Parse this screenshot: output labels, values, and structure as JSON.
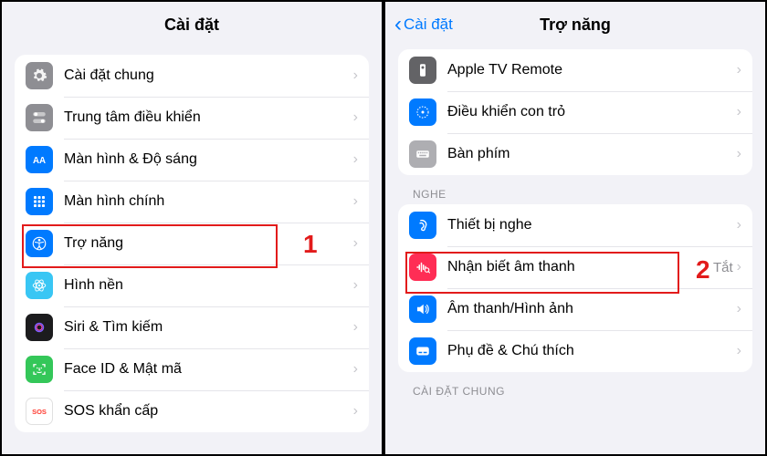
{
  "left": {
    "title": "Cài đặt",
    "items": [
      {
        "name": "general",
        "label": "Cài đặt chung",
        "icon": "gear",
        "bg": "bg-gray"
      },
      {
        "name": "controlcenter",
        "label": "Trung tâm điều khiển",
        "icon": "toggles",
        "bg": "bg-gray"
      },
      {
        "name": "display",
        "label": "Màn hình & Độ sáng",
        "icon": "aa",
        "bg": "bg-blue"
      },
      {
        "name": "homescreen",
        "label": "Màn hình chính",
        "icon": "grid",
        "bg": "bg-blue"
      },
      {
        "name": "accessibility",
        "label": "Trợ năng",
        "icon": "accessibility",
        "bg": "bg-blue"
      },
      {
        "name": "wallpaper",
        "label": "Hình nền",
        "icon": "atom",
        "bg": "bg-atom"
      },
      {
        "name": "siri",
        "label": "Siri & Tìm kiếm",
        "icon": "siri",
        "bg": "bg-black"
      },
      {
        "name": "faceid",
        "label": "Face ID & Mật mã",
        "icon": "faceid",
        "bg": "bg-green"
      },
      {
        "name": "sos",
        "label": "SOS khẩn cấp",
        "icon": "sos",
        "bg": "bg-white"
      }
    ],
    "annotation_number": "1"
  },
  "right": {
    "back_label": "Cài đặt",
    "title": "Trợ năng",
    "group_top": [
      {
        "name": "appletv",
        "label": "Apple TV Remote",
        "icon": "tvremote",
        "bg": "bg-darkgray"
      },
      {
        "name": "pointer",
        "label": "Điều khiển con trỏ",
        "icon": "pointer",
        "bg": "bg-blue"
      },
      {
        "name": "keyboard",
        "label": "Bàn phím",
        "icon": "keyboard",
        "bg": "bg-lightgray"
      }
    ],
    "section_hearing": "NGHE",
    "group_hearing": [
      {
        "name": "hearingdev",
        "label": "Thiết bị nghe",
        "icon": "ear",
        "bg": "bg-blue"
      },
      {
        "name": "soundrec",
        "label": "Nhận biết âm thanh",
        "icon": "soundrec",
        "bg": "bg-pink",
        "value": "Tắt"
      },
      {
        "name": "audiovisual",
        "label": "Âm thanh/Hình ảnh",
        "icon": "speaker",
        "bg": "bg-blue"
      },
      {
        "name": "subtitles",
        "label": "Phụ đề & Chú thích",
        "icon": "subtitle",
        "bg": "bg-blue"
      }
    ],
    "section_general": "CÀI ĐẶT CHUNG",
    "annotation_number": "2"
  }
}
